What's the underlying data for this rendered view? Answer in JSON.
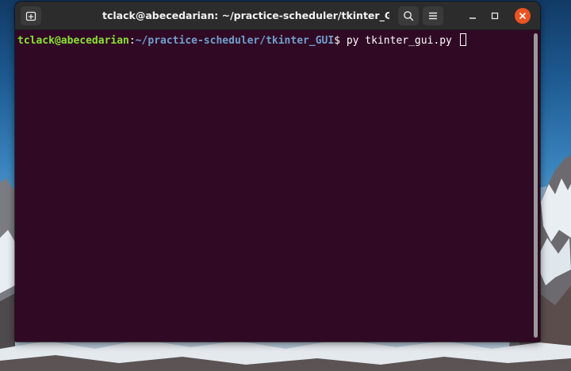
{
  "window": {
    "title": "tclack@abecedarian: ~/practice-scheduler/tkinter_GUI"
  },
  "titlebar": {
    "icons": {
      "new_tab": "new-tab-icon",
      "search": "search-icon",
      "menu": "hamburger-menu-icon",
      "minimize": "minimize-icon",
      "maximize": "maximize-icon",
      "close": "close-icon"
    }
  },
  "terminal": {
    "prompt_user": "tclack@abecedarian",
    "prompt_colon": ":",
    "prompt_path": "~/practice-scheduler/tkinter_GUI",
    "prompt_dollar": "$",
    "command": " py tkinter_gui.py "
  },
  "colors": {
    "terminal_bg": "#300a24",
    "prompt_user": "#8ae234",
    "prompt_path": "#729fcf",
    "close_button": "#e95420",
    "titlebar_bg": "#2c2c2c"
  }
}
